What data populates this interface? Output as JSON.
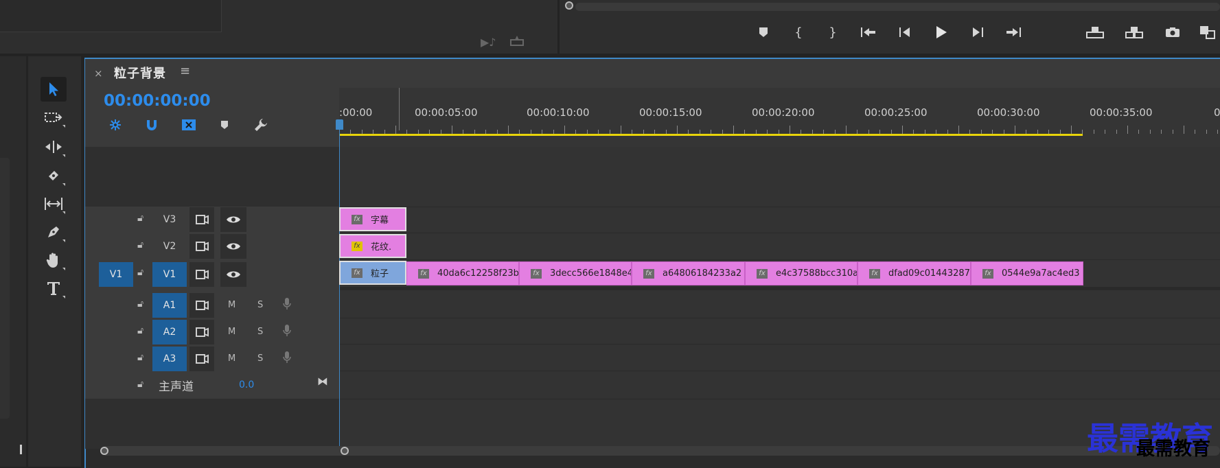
{
  "sequence": {
    "title": "粒子背景",
    "close_label": "×",
    "menu_label": "≡",
    "timecode": "00:00:00:00"
  },
  "ruler": {
    "labels": [
      ":00:00",
      "00:00:05:00",
      "00:00:10:00",
      "00:00:15:00",
      "00:00:20:00",
      "00:00:25:00",
      "00:00:30:00",
      "00:00:35:00",
      "0"
    ]
  },
  "video_tracks": [
    {
      "name": "V3",
      "clip_labels": [
        "字幕"
      ]
    },
    {
      "name": "V2",
      "clip_labels": [
        "花纹."
      ]
    },
    {
      "name": "V1",
      "source": "V1",
      "clip_labels": [
        "粒子",
        "40da6c12258f23b",
        "3decc566e1848e4",
        "a64806184233a2",
        "e4c37588bcc310a",
        "dfad09c01443287",
        "0544e9a7ac4ed3"
      ]
    }
  ],
  "audio_tracks": [
    {
      "name": "A1",
      "mute": "M",
      "solo": "S"
    },
    {
      "name": "A2",
      "mute": "M",
      "solo": "S"
    },
    {
      "name": "A3",
      "mute": "M",
      "solo": "S"
    }
  ],
  "master": {
    "label": "主声道",
    "value": "0.0"
  },
  "clip_fx_label": "fx",
  "colors": {
    "accent": "#3f89c8",
    "timecode": "#2d8ceb",
    "clip_pink": "#e37fe1",
    "clip_blue": "#7fa6dc",
    "work_area": "#e8d40a"
  },
  "watermark": {
    "big": "最需教育",
    "small": "最需教育"
  }
}
